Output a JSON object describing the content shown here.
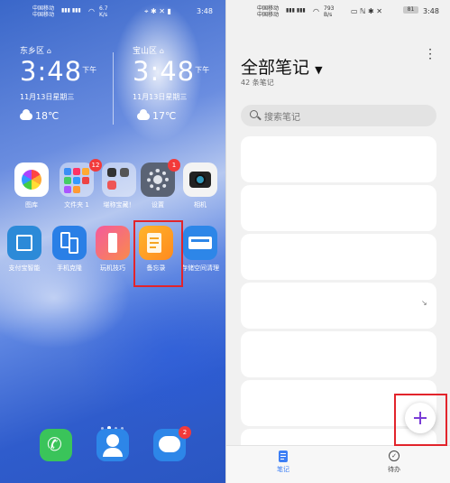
{
  "home": {
    "status": {
      "carrier1": "中国移动",
      "carrier2": "中国移动",
      "speed": "6.7",
      "speed_unit": "K/s",
      "time": "3:48"
    },
    "clocks": [
      {
        "location": "东乡区",
        "time": "3:48",
        "ampm": "下午",
        "date": "11月13日星期三",
        "temp": "18℃"
      },
      {
        "location": "宝山区",
        "time": "3:48",
        "ampm": "下午",
        "date": "11月13日星期三",
        "temp": "17℃"
      }
    ],
    "apps_row1": [
      {
        "label": "图库",
        "badge": ""
      },
      {
        "label": "文件夹 1",
        "badge": "12"
      },
      {
        "label": "堪称宝藏！",
        "badge": ""
      },
      {
        "label": "设置",
        "badge": "1"
      },
      {
        "label": "相机",
        "badge": ""
      }
    ],
    "apps_row2": [
      {
        "label": "支付宝智能",
        "badge": ""
      },
      {
        "label": "手机克隆",
        "badge": ""
      },
      {
        "label": "玩机技巧",
        "badge": ""
      },
      {
        "label": "备忘录",
        "badge": ""
      },
      {
        "label": "存储空间清理",
        "badge": ""
      }
    ],
    "dock_badge": "2",
    "colors": {
      "highlight": "#e2242b",
      "badge": "#f23a3a"
    }
  },
  "notes": {
    "status": {
      "carrier1": "中国移动",
      "carrier2": "中国移动",
      "speed": "793",
      "speed_unit": "B/s",
      "battery": "81",
      "time": "3:48"
    },
    "title": "全部笔记",
    "count": "42 条笔记",
    "search_placeholder": "搜索笔记",
    "tabs": [
      {
        "label": "笔记",
        "active": true
      },
      {
        "label": "待办",
        "active": false
      }
    ],
    "colors": {
      "accent": "#3d7ff5",
      "fab_plus": "#7a3cd6"
    }
  }
}
